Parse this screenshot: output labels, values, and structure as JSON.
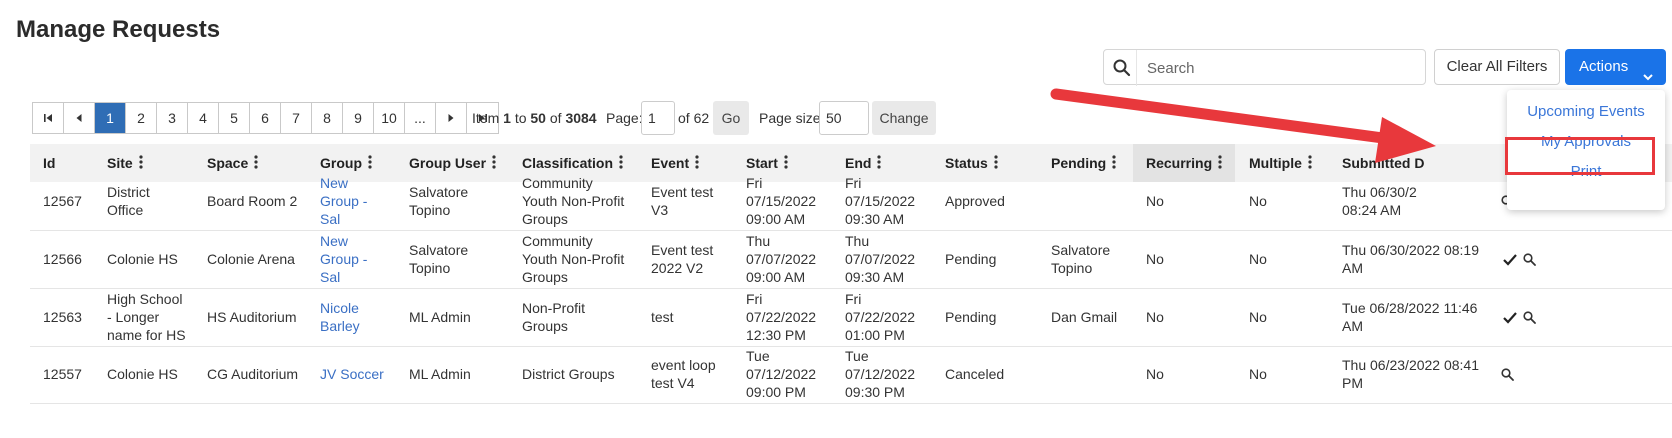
{
  "page": {
    "title": "Manage Requests"
  },
  "search": {
    "placeholder": "Search"
  },
  "toolbar": {
    "clear_label": "Clear All Filters",
    "actions_label": "Actions"
  },
  "pagination": {
    "pages": [
      "1",
      "2",
      "3",
      "4",
      "5",
      "6",
      "7",
      "8",
      "9",
      "10",
      "..."
    ],
    "current": "1",
    "item_prefix": "Item",
    "item_from": "1",
    "item_to_word": "to",
    "item_to": "50",
    "item_of_word": "of",
    "item_total": "3084",
    "page_label": "Page:",
    "page_value": "1",
    "of_pages": "of 62",
    "go_label": "Go",
    "page_size_label": "Page size:",
    "page_size_value": "50",
    "change_label": "Change"
  },
  "table": {
    "columns": [
      "Id",
      "Site",
      "Space",
      "Group",
      "Group User",
      "Classification",
      "Event",
      "Start",
      "End",
      "Status",
      "Pending",
      "Recurring",
      "Multiple",
      "Submitted D"
    ],
    "rows": [
      {
        "id": "12567",
        "site": [
          "District",
          "Office"
        ],
        "space": "Board Room 2",
        "group": [
          "New",
          "Group -",
          "Sal"
        ],
        "group_user": [
          "Salvatore",
          "Topino"
        ],
        "classification": [
          "Community",
          "Youth Non-Profit",
          "Groups"
        ],
        "event": [
          "Event test",
          "V3"
        ],
        "start": [
          "Fri",
          "07/15/2022",
          "09:00 AM"
        ],
        "end": [
          "Fri",
          "07/15/2022",
          "09:30 AM"
        ],
        "status": "Approved",
        "pending": [],
        "recurring": "No",
        "multiple": "No",
        "submitted": [
          "Thu 06/30/2",
          "08:24 AM"
        ],
        "actions": [
          "search-icon"
        ]
      },
      {
        "id": "12566",
        "site": [
          "Colonie HS"
        ],
        "space": "Colonie Arena",
        "group": [
          "New",
          "Group -",
          "Sal"
        ],
        "group_user": [
          "Salvatore",
          "Topino"
        ],
        "classification": [
          "Community",
          "Youth Non-Profit",
          "Groups"
        ],
        "event": [
          "Event test",
          "2022 V2"
        ],
        "start": [
          "Thu",
          "07/07/2022",
          "09:00 AM"
        ],
        "end": [
          "Thu",
          "07/07/2022",
          "09:30 AM"
        ],
        "status": "Pending",
        "pending": [
          "Salvatore",
          "Topino"
        ],
        "recurring": "No",
        "multiple": "No",
        "submitted": [
          "Thu 06/30/2022 08:19",
          "AM"
        ],
        "actions": [
          "check-icon",
          "search-icon"
        ]
      },
      {
        "id": "12563",
        "site": [
          "High School",
          "- Longer",
          "name for HS"
        ],
        "space": "HS Auditorium",
        "group": [
          "Nicole",
          "Barley"
        ],
        "group_user": [
          "ML Admin"
        ],
        "classification": [
          "Non-Profit",
          "Groups"
        ],
        "event": [
          "test"
        ],
        "start": [
          "Fri",
          "07/22/2022",
          "12:30 PM"
        ],
        "end": [
          "Fri",
          "07/22/2022",
          "01:00 PM"
        ],
        "status": "Pending",
        "pending": [
          "Dan Gmail"
        ],
        "recurring": "No",
        "multiple": "No",
        "submitted": [
          "Tue 06/28/2022 11:46",
          "AM"
        ],
        "actions": [
          "check-icon",
          "search-icon"
        ]
      },
      {
        "id": "12557",
        "site": [
          "Colonie HS"
        ],
        "space": "CG Auditorium",
        "group": [
          "JV Soccer"
        ],
        "group_user": [
          "ML Admin"
        ],
        "classification": [
          "District Groups"
        ],
        "event": [
          "event loop",
          "test V4"
        ],
        "start": [
          "Tue",
          "07/12/2022",
          "09:00 PM"
        ],
        "end": [
          "Tue",
          "07/12/2022",
          "09:30 PM"
        ],
        "status": "Canceled",
        "pending": [],
        "recurring": "No",
        "multiple": "No",
        "submitted": [
          "Thu 06/23/2022 08:41",
          "PM"
        ],
        "actions": [
          "search-icon"
        ]
      }
    ]
  },
  "actions_menu": {
    "items": [
      "Upcoming Events",
      "My Approvals",
      "Print"
    ],
    "highlighted": "My Approvals"
  },
  "colors": {
    "primary": "#1a73e8",
    "link": "#3a6fc4",
    "highlight": "#e8383c",
    "active_page": "#2f6db5"
  }
}
